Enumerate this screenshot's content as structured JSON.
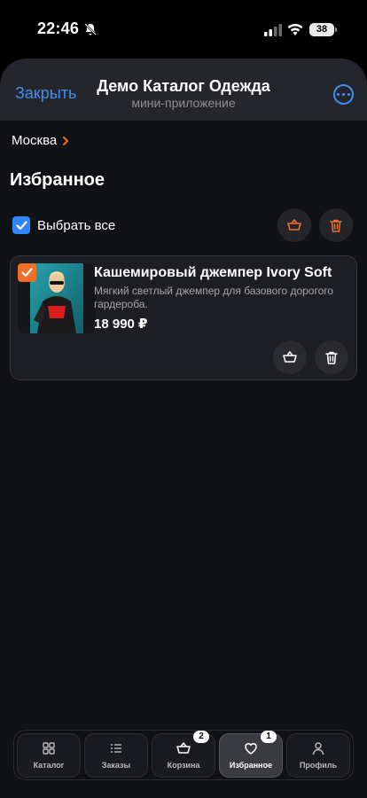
{
  "status": {
    "time": "22:46",
    "battery": "38"
  },
  "header": {
    "close": "Закрыть",
    "title": "Демо Каталог Одежда",
    "subtitle": "мини-приложение"
  },
  "location": {
    "city": "Москва"
  },
  "page": {
    "title": "Избранное",
    "select_all": "Выбрать все"
  },
  "product": {
    "name": "Кашемировый джемпер Ivory Soft",
    "description": "Мягкий светлый джемпер для базового дорогого гардероба.",
    "price": "18 990 ₽",
    "selected": true
  },
  "tabs": [
    {
      "label": "Каталог",
      "icon": "grid-icon",
      "badge": ""
    },
    {
      "label": "Заказы",
      "icon": "list-icon",
      "badge": ""
    },
    {
      "label": "Корзина",
      "icon": "basket-icon",
      "badge": "2"
    },
    {
      "label": "Избранное",
      "icon": "heart-icon",
      "badge": "1",
      "active": true
    },
    {
      "label": "Профиль",
      "icon": "person-icon",
      "badge": ""
    }
  ],
  "colors": {
    "accent_blue": "#3f8ff7",
    "accent_orange": "#ee6f2a",
    "background": "#111216"
  }
}
